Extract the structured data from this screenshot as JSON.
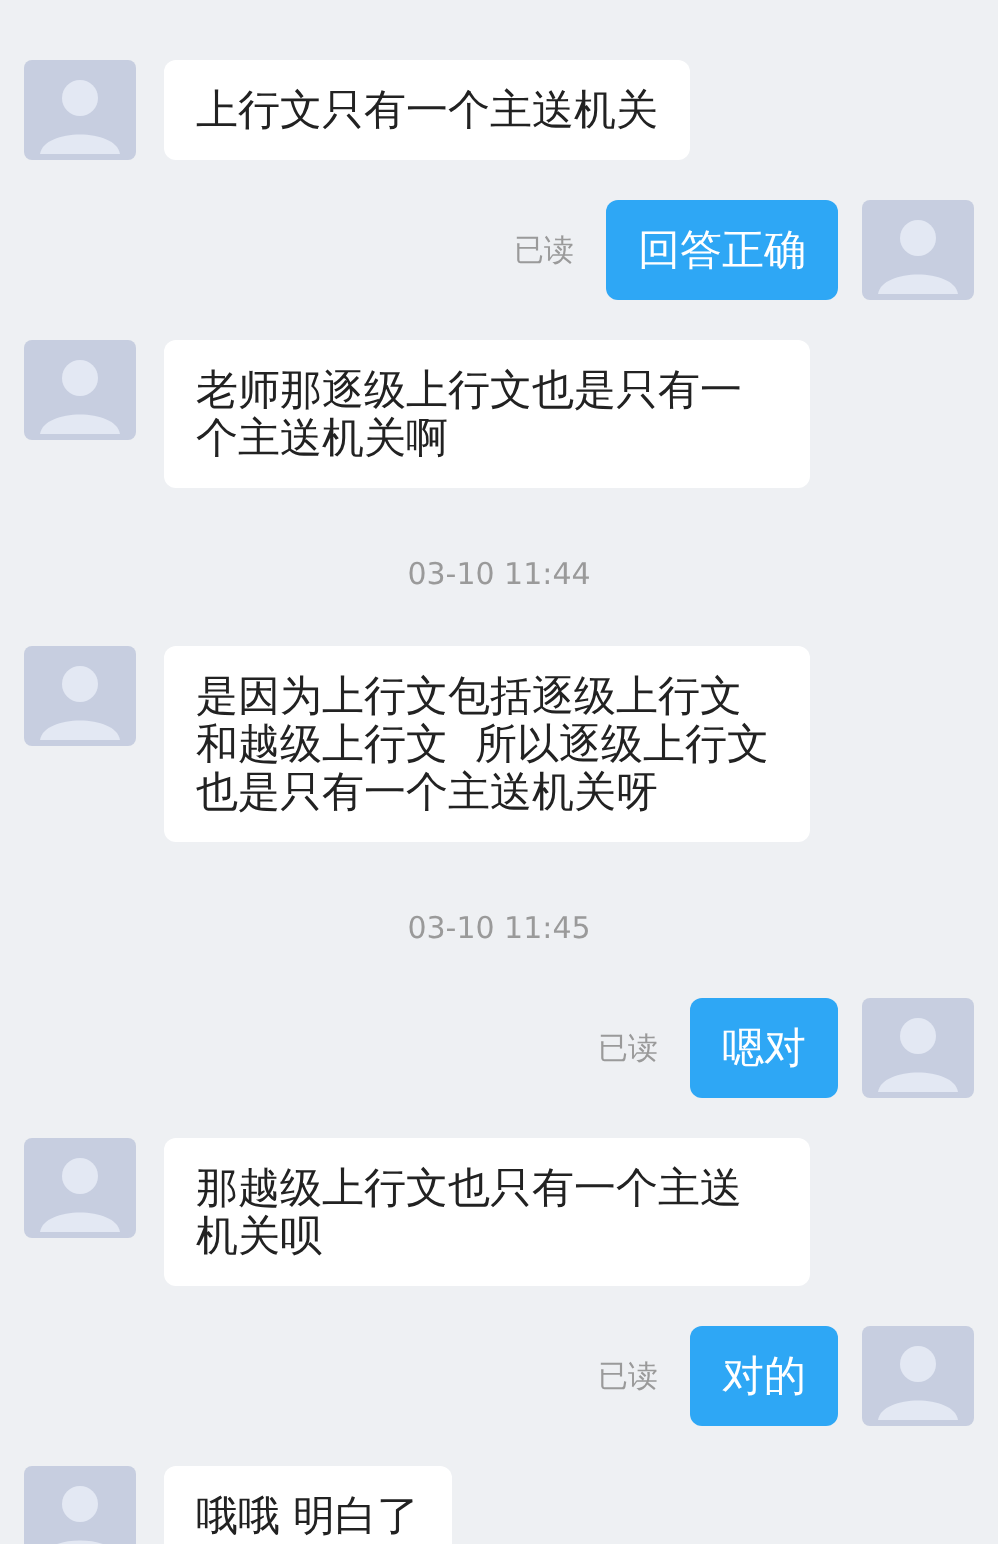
{
  "messages": [
    {
      "kind": "received",
      "text": "上行文只有一个主送机关"
    },
    {
      "kind": "sent",
      "text": "回答正确",
      "status": "已读"
    },
    {
      "kind": "received",
      "text": "老师那逐级上行文也是只有一个主送机关啊"
    },
    {
      "kind": "time",
      "text": "03-10 11:44"
    },
    {
      "kind": "received",
      "text": "是因为上行文包括逐级上行文和越级上行文  所以逐级上行文也是只有一个主送机关呀"
    },
    {
      "kind": "time",
      "text": "03-10 11:45"
    },
    {
      "kind": "sent",
      "text": "嗯对",
      "status": "已读"
    },
    {
      "kind": "received",
      "text": "那越级上行文也只有一个主送机关呗"
    },
    {
      "kind": "sent",
      "text": "对的",
      "status": "已读"
    },
    {
      "kind": "received",
      "text": "哦哦 明白了"
    }
  ]
}
